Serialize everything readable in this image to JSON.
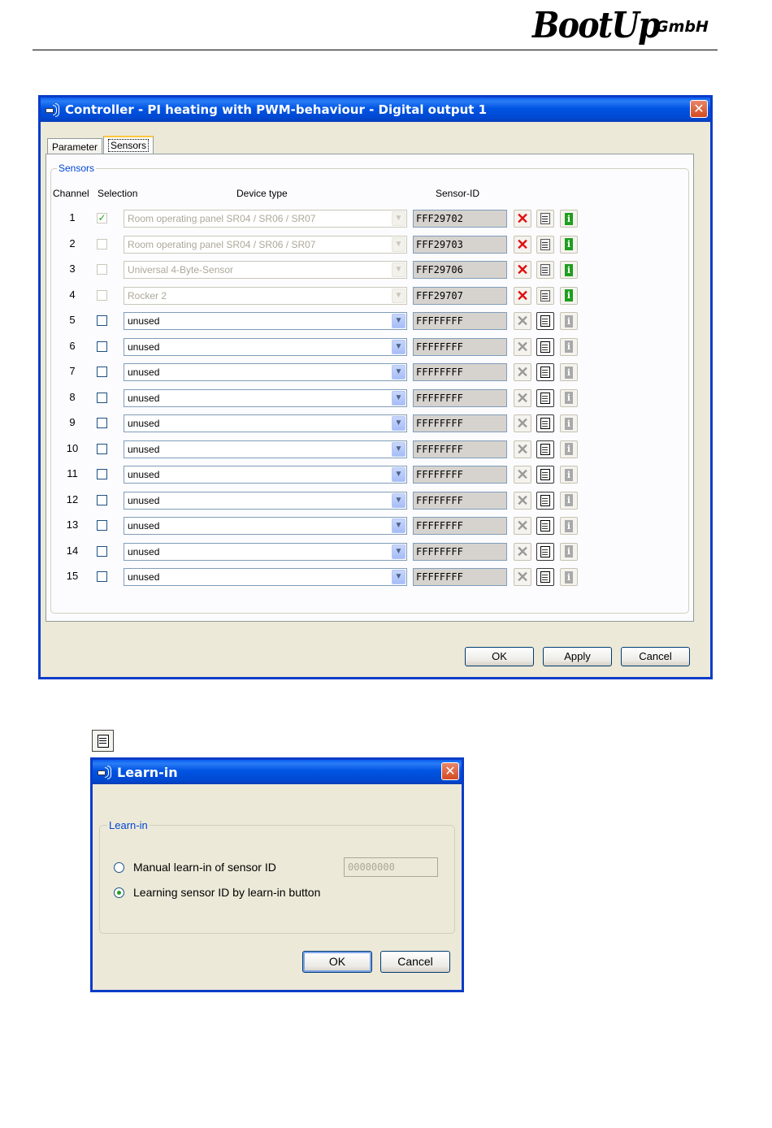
{
  "header": {
    "brand_main": "BootUp",
    "brand_sub": "GmbH"
  },
  "controller_window": {
    "title": "Controller - PI heating with PWM-behaviour - Digital output 1",
    "tabs": [
      "Parameter",
      "Sensors"
    ],
    "active_tab": "Sensors",
    "group_label": "Sensors",
    "columns": {
      "channel": "Channel",
      "selection": "Selection",
      "device_type": "Device type",
      "sensor_id": "Sensor-ID"
    },
    "rows": [
      {
        "channel": "1",
        "checked": true,
        "enabled": false,
        "device": "Room operating panel SR04 / SR06 / SR07",
        "sensor_id": "FFF29702"
      },
      {
        "channel": "2",
        "checked": false,
        "enabled": false,
        "device": "Room operating panel SR04 / SR06 / SR07",
        "sensor_id": "FFF29703"
      },
      {
        "channel": "3",
        "checked": false,
        "enabled": false,
        "device": "Universal 4-Byte-Sensor",
        "sensor_id": "FFF29706"
      },
      {
        "channel": "4",
        "checked": false,
        "enabled": false,
        "device": "Rocker 2",
        "sensor_id": "FFF29707"
      },
      {
        "channel": "5",
        "checked": false,
        "enabled": true,
        "device": "unused",
        "sensor_id": "FFFFFFFF"
      },
      {
        "channel": "6",
        "checked": false,
        "enabled": true,
        "device": "unused",
        "sensor_id": "FFFFFFFF"
      },
      {
        "channel": "7",
        "checked": false,
        "enabled": true,
        "device": "unused",
        "sensor_id": "FFFFFFFF"
      },
      {
        "channel": "8",
        "checked": false,
        "enabled": true,
        "device": "unused",
        "sensor_id": "FFFFFFFF"
      },
      {
        "channel": "9",
        "checked": false,
        "enabled": true,
        "device": "unused",
        "sensor_id": "FFFFFFFF"
      },
      {
        "channel": "10",
        "checked": false,
        "enabled": true,
        "device": "unused",
        "sensor_id": "FFFFFFFF"
      },
      {
        "channel": "11",
        "checked": false,
        "enabled": true,
        "device": "unused",
        "sensor_id": "FFFFFFFF"
      },
      {
        "channel": "12",
        "checked": false,
        "enabled": true,
        "device": "unused",
        "sensor_id": "FFFFFFFF"
      },
      {
        "channel": "13",
        "checked": false,
        "enabled": true,
        "device": "unused",
        "sensor_id": "FFFFFFFF"
      },
      {
        "channel": "14",
        "checked": false,
        "enabled": true,
        "device": "unused",
        "sensor_id": "FFFFFFFF"
      },
      {
        "channel": "15",
        "checked": false,
        "enabled": true,
        "device": "unused",
        "sensor_id": "FFFFFFFF"
      }
    ],
    "buttons": {
      "ok": "OK",
      "apply": "Apply",
      "cancel": "Cancel"
    }
  },
  "learn_dialog": {
    "title": "Learn-in",
    "group_label": "Learn-in",
    "option_manual": "Manual learn-in of sensor ID",
    "option_button": "Learning sensor ID by learn-in button",
    "manual_id_value": "00000000",
    "selected_option": "button",
    "buttons": {
      "ok": "OK",
      "cancel": "Cancel"
    }
  },
  "icons": {
    "app": "wireless-sensor-icon",
    "delete": "delete-x-icon",
    "learn": "learn-in-icon",
    "info": "info-icon",
    "close": "close-icon"
  },
  "colors": {
    "title_bar": "#0054e3",
    "window_bg": "#ece9d8",
    "group_label": "#0046d5",
    "delete_active": "#e01010",
    "info_active": "#1e9e1e"
  }
}
